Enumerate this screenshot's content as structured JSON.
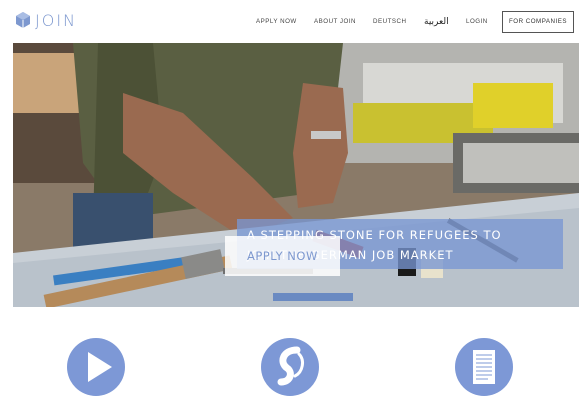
{
  "brand": {
    "name": "JOIN",
    "accent": "#7d98cf"
  },
  "nav": {
    "items": [
      {
        "label": "APPLY NOW"
      },
      {
        "label": "ABOUT JOIN"
      },
      {
        "label": "DEUTSCH"
      },
      {
        "label": "العربية"
      },
      {
        "label": "LOGIN"
      }
    ],
    "companies_button": "FOR COMPANIES"
  },
  "hero": {
    "tagline": [
      "A STEPPING STONE FOR REFUGEES TO",
      "JOIN THE GERMAN JOB MARKET"
    ],
    "cta_label": "APPLY NOW"
  },
  "features": [
    {
      "icon": "play-icon"
    },
    {
      "icon": "join-swirl-icon"
    },
    {
      "icon": "document-icon"
    }
  ]
}
